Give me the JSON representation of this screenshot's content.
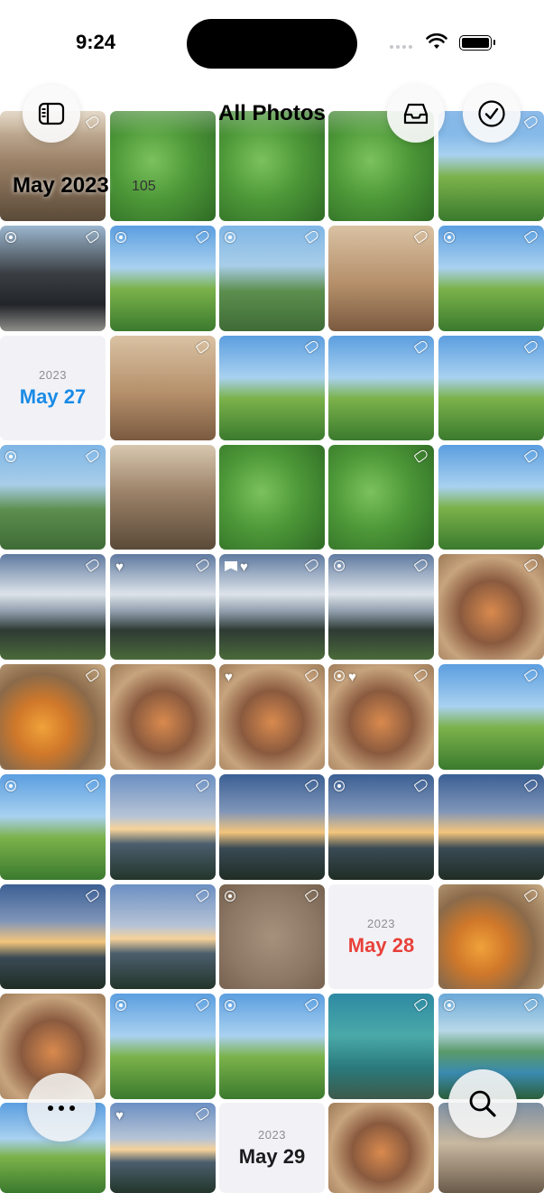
{
  "status_bar": {
    "time": "9:24"
  },
  "header": {
    "title": "All Photos",
    "sidebar_icon": "sidebar-icon",
    "inbox_icon": "tray-icon",
    "select_icon": "checkmark-circle-icon"
  },
  "section": {
    "label": "May 2023",
    "count": "105"
  },
  "date_cards": [
    {
      "year": "2023",
      "day": "May 27",
      "color": "#1a8be6"
    },
    {
      "year": "2023",
      "day": "May 28",
      "color": "#e8413a"
    },
    {
      "year": "2023",
      "day": "May 29",
      "color": "#1c1c1e"
    }
  ],
  "bottom_bar": {
    "more_icon": "ellipsis-icon",
    "search_icon": "magnifying-glass-icon"
  }
}
